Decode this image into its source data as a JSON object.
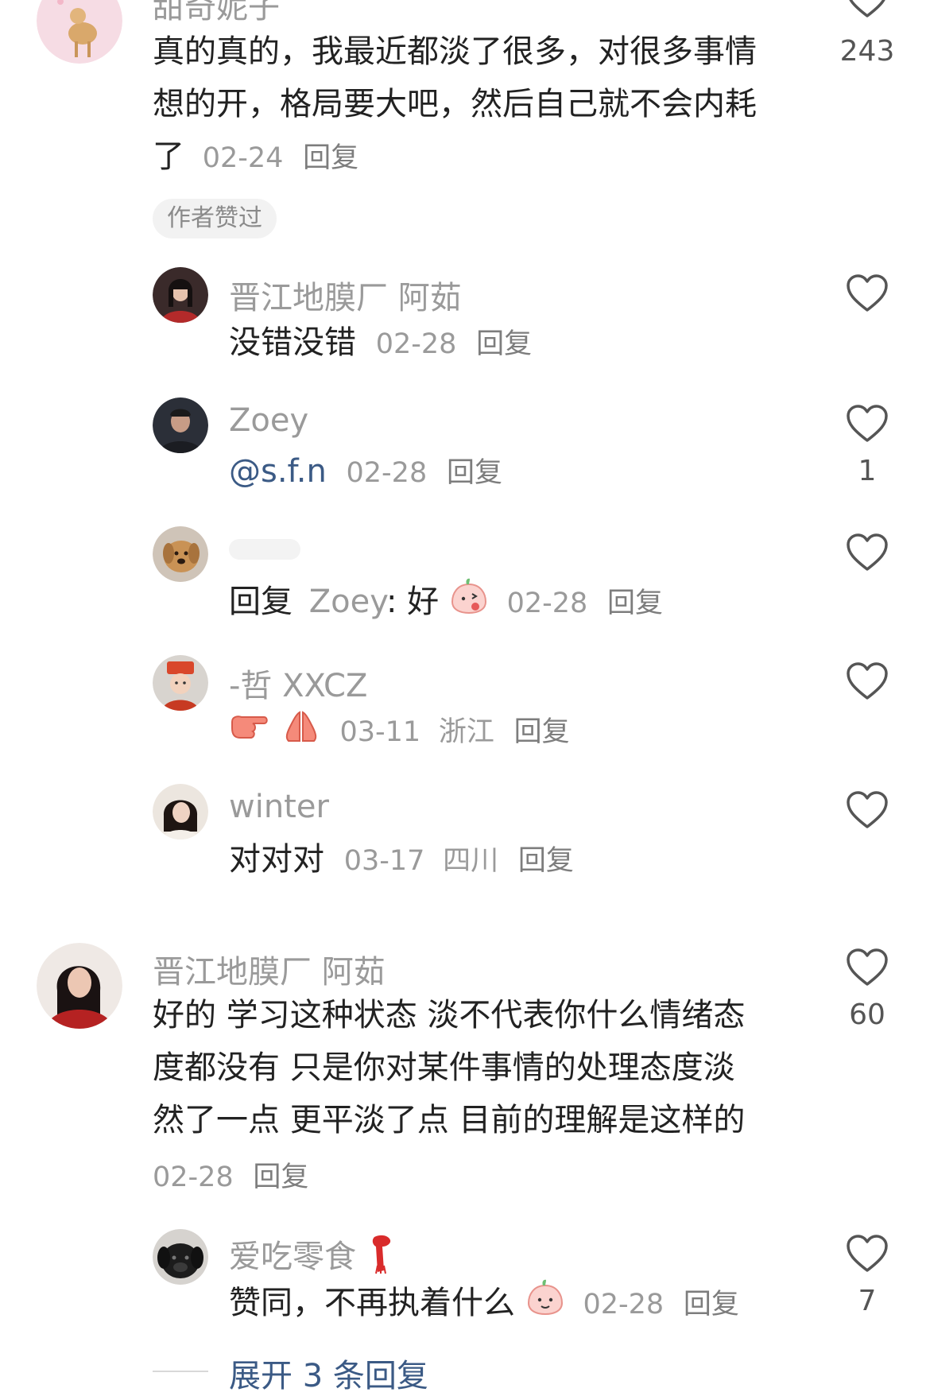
{
  "comments": [
    {
      "id": "c1",
      "username": "甜奇妮子",
      "text_lines": [
        "真的真的，我最近都淡了很多，对很多事情",
        "想的开，格局要大吧，然后自己就不会内耗",
        "了"
      ],
      "date": "02-24",
      "reply_label": "回复",
      "likes": "243",
      "badge": "作者赞过"
    },
    {
      "id": "r1",
      "username": "晋江地膜厂 阿茹",
      "text": "没错没错",
      "date": "02-28",
      "reply_label": "回复"
    },
    {
      "id": "r2",
      "username": "Zoey",
      "mention": "@s.f.n",
      "date": "02-28",
      "reply_label": "回复",
      "likes": "1"
    },
    {
      "id": "r3",
      "reply_prefix": "回复",
      "reply_to": "Zoey",
      "text": ": 好",
      "date": "02-28",
      "reply_label": "回复"
    },
    {
      "id": "r4",
      "username": "-哲 XXCZ",
      "date": "03-11",
      "location": "浙江",
      "reply_label": "回复"
    },
    {
      "id": "r5",
      "username": "winter",
      "text": "对对对",
      "date": "03-17",
      "location": "四川",
      "reply_label": "回复"
    },
    {
      "id": "c2",
      "username": "晋江地膜厂 阿茹",
      "text_lines": [
        "好的 学习这种状态 淡不代表你什么情绪态",
        "度都没有 只是你对某件事情的处理态度淡",
        "然了一点 更平淡了点 目前的理解是这样的"
      ],
      "date": "02-28",
      "reply_label": "回复",
      "likes": "60"
    },
    {
      "id": "r6",
      "username": "爱吃零食",
      "text": "赞同，不再执着什么",
      "date": "02-28",
      "reply_label": "回复",
      "likes": "7"
    }
  ],
  "expand_label": "展开 3 条回复",
  "icons": {
    "like": "heart-outline-icon",
    "emoji_face": "peach-face-emoji",
    "emoji_point": "pointing-hand-emoji",
    "emoji_pray": "praying-hands-emoji",
    "emoji_scarf": "red-scarf-emoji"
  },
  "colors": {
    "text": "#222222",
    "muted": "#9a9a9a",
    "link": "#3b5a85",
    "badge_bg": "#f2f2f2"
  }
}
